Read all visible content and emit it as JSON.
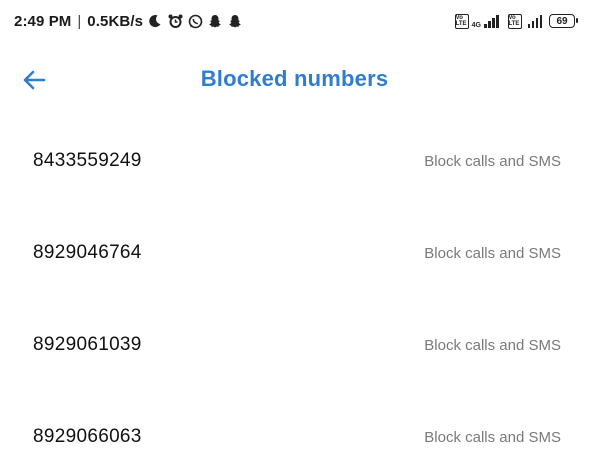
{
  "status_bar": {
    "time": "2:49 PM",
    "separator": "|",
    "speed": "0.5KB/s",
    "left_icons": [
      "moon-icon",
      "alarm-icon",
      "whatsapp-icon",
      "snapchat-icon",
      "snapchat-icon"
    ],
    "sim1": {
      "volte_label": "Vo LTE",
      "network": "4G"
    },
    "sim2": {
      "volte_label": "Vo LTE"
    },
    "battery": "69"
  },
  "header": {
    "back_icon": "arrow-left-icon",
    "title": "Blocked numbers"
  },
  "blocked_list": [
    {
      "number": "8433559249",
      "status": "Block calls and SMS"
    },
    {
      "number": "8929046764",
      "status": "Block calls and SMS"
    },
    {
      "number": "8929061039",
      "status": "Block calls and SMS"
    },
    {
      "number": "8929066063",
      "status": "Block calls and SMS"
    }
  ],
  "colors": {
    "accent": "#2f7dd1",
    "text_primary": "#111111",
    "text_secondary": "#7a7a7a",
    "background": "#ffffff"
  }
}
